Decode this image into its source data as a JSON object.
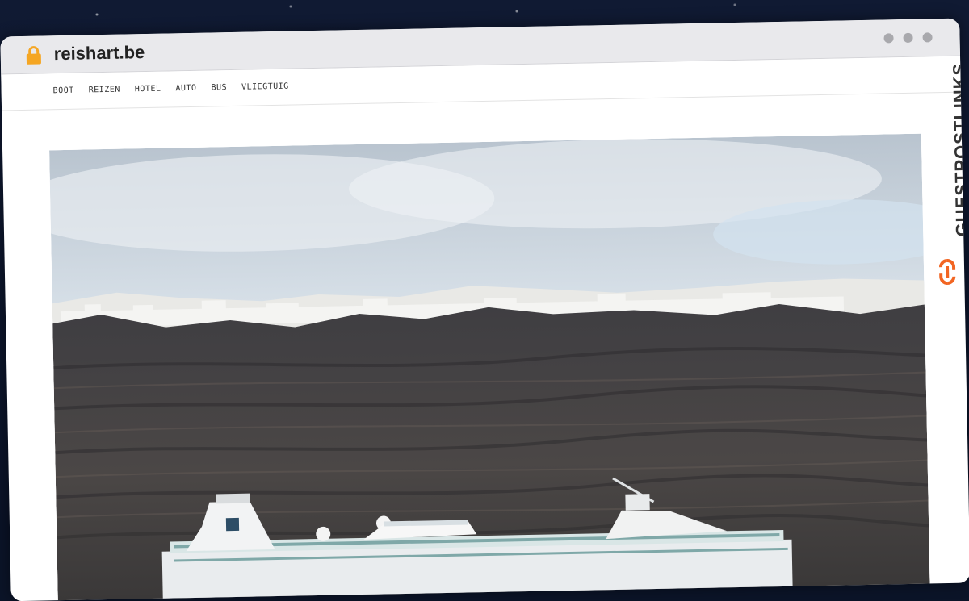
{
  "browser": {
    "domain": "reishart.be",
    "lock_icon": "lock-icon",
    "window_controls": [
      "dot",
      "dot",
      "dot"
    ]
  },
  "nav": {
    "items": [
      {
        "label": "BOOT"
      },
      {
        "label": "REIZEN"
      },
      {
        "label": "HOTEL"
      },
      {
        "label": "AUTO"
      },
      {
        "label": "BUS"
      },
      {
        "label": "VLIEGTUIG"
      }
    ]
  },
  "brand": {
    "text": "GUESTPOSTLINKS",
    "accent_color": "#f26522",
    "icon": "chain-link-icon"
  },
  "hero": {
    "image": "cruise-ship-below-cliffs-photo"
  },
  "colors": {
    "window_bg": "#ffffff",
    "titlebar_bg": "#e9e9ec",
    "lock_color": "#f5a623"
  }
}
